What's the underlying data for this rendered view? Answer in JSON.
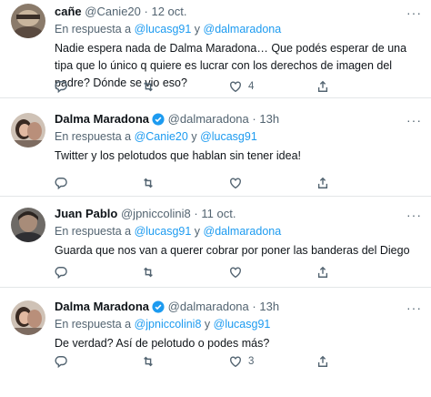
{
  "tweets": [
    {
      "name": "cañe",
      "handle": "@Canie20",
      "sep": "·",
      "time": "12 oct.",
      "reply_prefix": "En respuesta a",
      "mention1": "@lucasg91",
      "conj": "y",
      "mention2": "@dalmaradona",
      "text": "Nadie espera nada de Dalma Maradona… Que podés esperar de una tipa que lo único q quiere es lucrar con los derechos de imagen del padre? Dónde se vio eso?",
      "counts": {
        "reply": "",
        "retweet": "",
        "like": "4",
        "share": ""
      },
      "verified": false
    },
    {
      "name": "Dalma Maradona",
      "handle": "@dalmaradona",
      "sep": "·",
      "time": "13h",
      "reply_prefix": "En respuesta a",
      "mention1": "@Canie20",
      "conj": "y",
      "mention2": "@lucasg91",
      "text": "Twitter y los pelotudos que hablan sin tener idea!",
      "counts": {
        "reply": "",
        "retweet": "",
        "like": "",
        "share": ""
      },
      "verified": true
    },
    {
      "name": "Juan Pablo",
      "handle": "@jpniccolini8",
      "sep": "·",
      "time": "11 oct.",
      "reply_prefix": "En respuesta a",
      "mention1": "@lucasg91",
      "conj": "y",
      "mention2": "@dalmaradona",
      "text": "Guarda que nos van a querer cobrar por poner las banderas del Diego",
      "counts": {
        "reply": "",
        "retweet": "",
        "like": "",
        "share": ""
      },
      "verified": false
    },
    {
      "name": "Dalma Maradona",
      "handle": "@dalmaradona",
      "sep": "·",
      "time": "13h",
      "reply_prefix": "En respuesta a",
      "mention1": "@jpniccolini8",
      "conj": "y",
      "mention2": "@lucasg91",
      "text": "De verdad? Así de pelotudo o podes más?",
      "counts": {
        "reply": "",
        "retweet": "",
        "like": "3",
        "share": ""
      },
      "verified": true
    }
  ],
  "colors": {
    "accent": "#1d9bf0",
    "muted": "#536471",
    "text": "#0f1419"
  },
  "icons": [
    "reply-icon",
    "retweet-icon",
    "like-icon",
    "share-icon",
    "verified-badge-icon",
    "more-icon"
  ]
}
